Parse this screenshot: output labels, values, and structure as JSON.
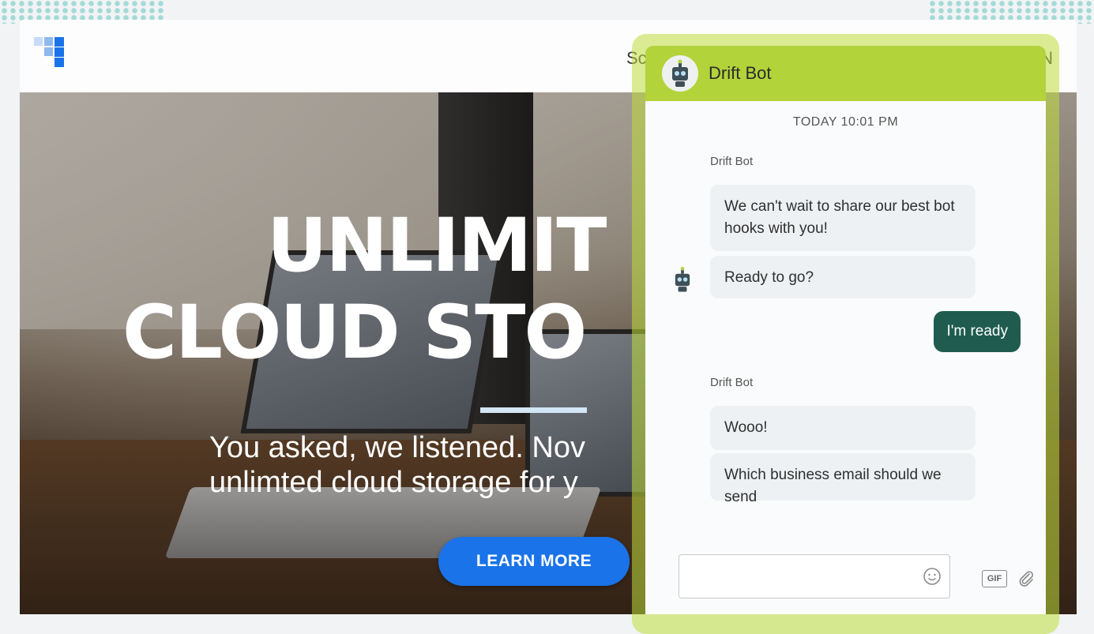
{
  "site": {
    "nav_partial_left": "Sc",
    "nav_partial_right": "N"
  },
  "hero": {
    "title_line1": "UNLIMIT",
    "title_line2": "CLOUD STO",
    "subtitle_line1": "You asked, we listened. Nov",
    "subtitle_line2": "unlimted cloud storage for y",
    "cta_label": "LEARN MORE"
  },
  "chat": {
    "bot_name": "Drift Bot",
    "timestamp": "TODAY 10:01 PM",
    "messages": [
      {
        "sender": "Drift Bot",
        "text": "We can't wait to share our best bot hooks with you!"
      },
      {
        "text": "Ready to go?"
      },
      {
        "user": true,
        "text": "I'm ready"
      },
      {
        "sender": "Drift Bot",
        "text": "Wooo!"
      },
      {
        "text": "Which business email should we send"
      }
    ],
    "gif_label": "GIF"
  },
  "colors": {
    "chat_header": "#b3d33a",
    "user_bubble": "#1f5c4f",
    "cta": "#1a73e8"
  },
  "icons": [
    "logo-icon",
    "bot-avatar-icon",
    "emoji-icon",
    "attach-icon"
  ]
}
